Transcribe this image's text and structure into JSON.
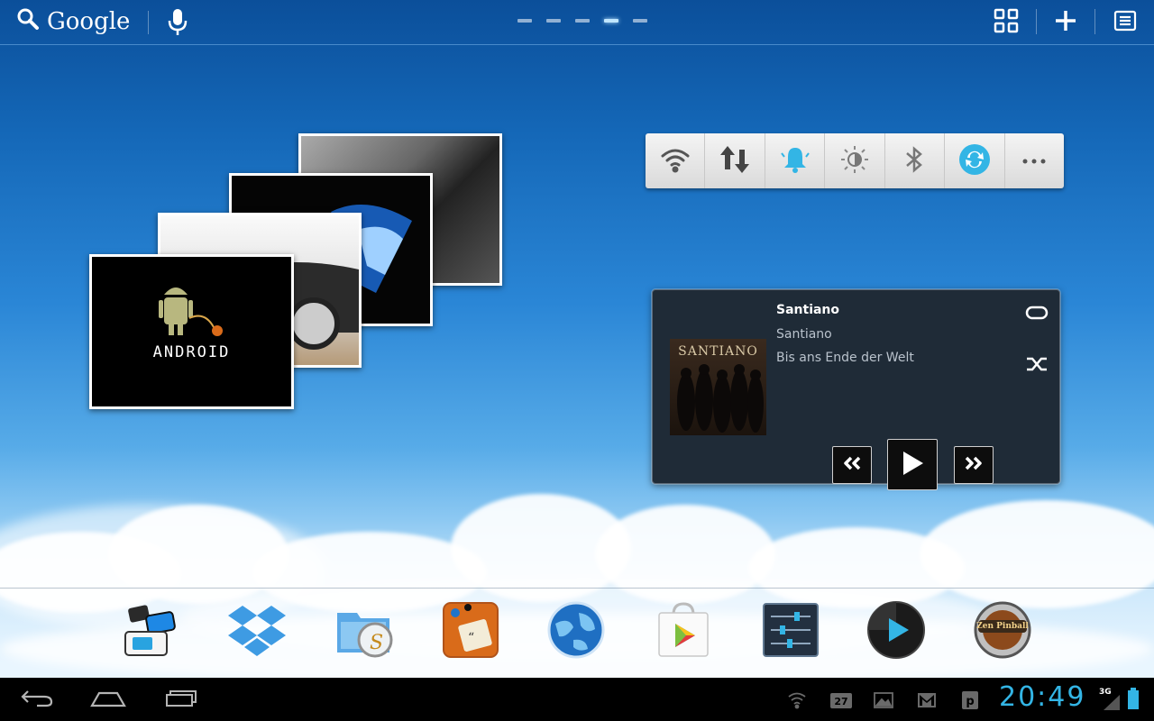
{
  "search": {
    "label": "Google"
  },
  "home_pages": {
    "count": 5,
    "active_index": 3
  },
  "photo_widget": {
    "front_caption": "ANDROID"
  },
  "quick_settings": {
    "items": [
      {
        "icon": "wifi-icon"
      },
      {
        "icon": "mobile-data-icon"
      },
      {
        "icon": "sound-icon"
      },
      {
        "icon": "brightness-icon"
      },
      {
        "icon": "bluetooth-icon"
      },
      {
        "icon": "sync-icon"
      },
      {
        "icon": "more-icon"
      }
    ]
  },
  "music": {
    "title": "Santiano",
    "artist": "Santiano",
    "song": "Bis ans Ende der Welt",
    "album_text": "SANTIANO"
  },
  "dock": {
    "apps": [
      {
        "icon": "app-switcher-icon"
      },
      {
        "icon": "dropbox-icon"
      },
      {
        "icon": "file-manager-icon"
      },
      {
        "icon": "notes-app-icon"
      },
      {
        "icon": "browser-globe-icon"
      },
      {
        "icon": "play-store-icon"
      },
      {
        "icon": "settings-sliders-icon"
      },
      {
        "icon": "media-player-icon"
      },
      {
        "icon": "pinball-game-icon"
      }
    ],
    "game_label": "Zen Pinball"
  },
  "status": {
    "time": "20:49",
    "network": "3G",
    "calendar_badge": "27"
  },
  "colors": {
    "accent": "#33b5e5"
  }
}
